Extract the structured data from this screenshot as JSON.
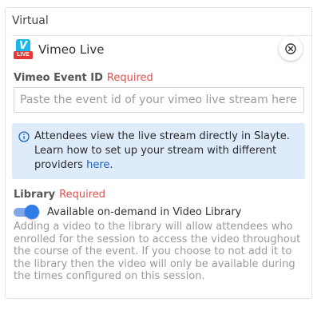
{
  "section": {
    "title": "Virtual"
  },
  "provider": {
    "name": "Vimeo Live",
    "logo_badge": "LIVE",
    "logo_icon": "vimeo-live-logo"
  },
  "event_id_field": {
    "label": "Vimeo Event ID",
    "required": "Required",
    "value": "",
    "placeholder": "Paste the event id of your vimeo live stream here"
  },
  "info": {
    "icon": "info-icon",
    "text": "Attendees view the live stream directly in Slayte. Learn how to set up your stream with different providers ",
    "link": "here",
    "end": "."
  },
  "library": {
    "label": "Library",
    "required": "Required",
    "toggle_on": true,
    "toggle_label": "Available on-demand in Video Library",
    "help": "Adding a video to the library will allow attendees who enrolled for the session to access the video throughout the course of the event. If you choose to not add it to the library then the video will only be available during the times configured on this session."
  },
  "colors": {
    "accent": "#2f7be8",
    "required": "#d9534f",
    "info_bg": "#deebfb",
    "link": "#1a5fc4"
  }
}
